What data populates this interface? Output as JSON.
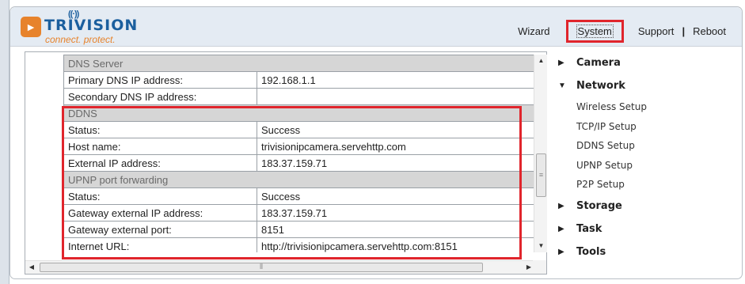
{
  "brand": {
    "name": "TRIVISION",
    "tagline": "connect. protect."
  },
  "topnav": {
    "wizard": "Wizard",
    "system": "System",
    "support": "Support",
    "separator": "|",
    "reboot": "Reboot"
  },
  "table": {
    "rows": [
      {
        "type": "section",
        "label": "DNS Server"
      },
      {
        "type": "row",
        "label": "Primary DNS IP address:",
        "value": "192.168.1.1"
      },
      {
        "type": "row",
        "label": "Secondary DNS IP address:",
        "value": ""
      },
      {
        "type": "section",
        "label": "DDNS"
      },
      {
        "type": "row",
        "label": "Status:",
        "value": "Success"
      },
      {
        "type": "row",
        "label": "Host name:",
        "value": "trivisionipcamera.servehttp.com"
      },
      {
        "type": "row",
        "label": "External IP address:",
        "value": "183.37.159.71"
      },
      {
        "type": "section",
        "label": "UPNP port forwarding"
      },
      {
        "type": "row",
        "label": "Status:",
        "value": "Success"
      },
      {
        "type": "row",
        "label": "Gateway external IP address:",
        "value": "183.37.159.71"
      },
      {
        "type": "row",
        "label": "Gateway external port:",
        "value": "8151"
      },
      {
        "type": "row",
        "label": "Internet URL:",
        "value": "http://trivisionipcamera.servehttp.com:8151"
      }
    ]
  },
  "sidebar": {
    "camera": "Camera",
    "network": "Network",
    "network_items": [
      "Wireless Setup",
      "TCP/IP Setup",
      "DDNS Setup",
      "UPNP Setup",
      "P2P Setup"
    ],
    "storage": "Storage",
    "task": "Task",
    "tools": "Tools"
  },
  "icons": {
    "collapsed": "triangle-right-icon",
    "expanded": "triangle-down-icon"
  },
  "colors": {
    "highlight": "#e0252c",
    "brand_blue": "#1b5f9e",
    "brand_orange": "#e7832c",
    "header_bg": "#e4ebf3",
    "section_bg": "#d6d6d6"
  }
}
